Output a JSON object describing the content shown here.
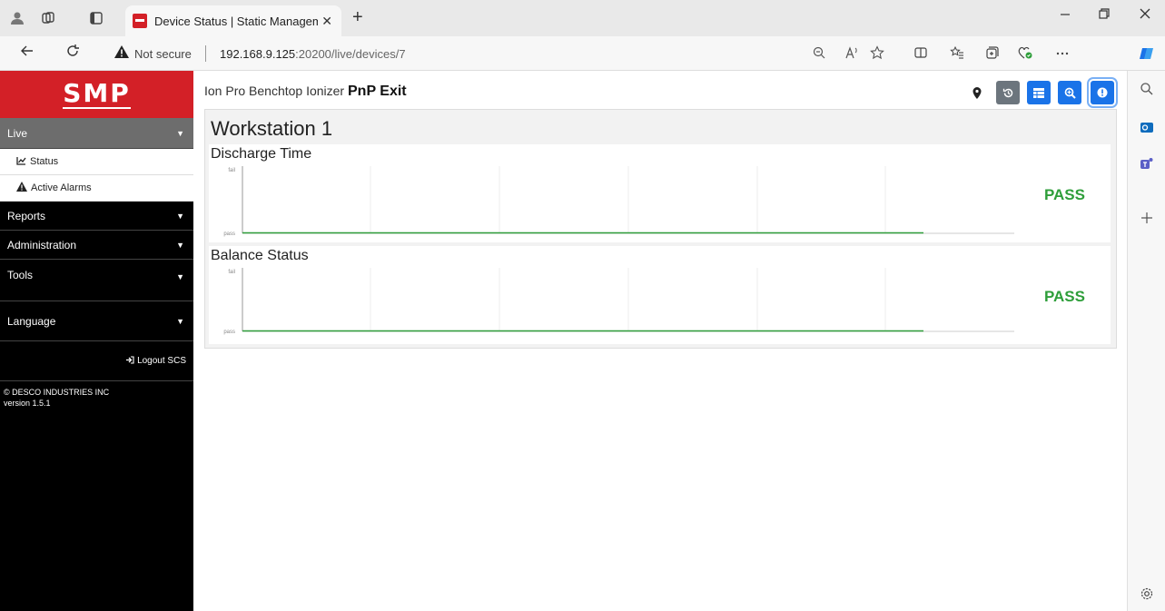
{
  "browser": {
    "tab_title": "Device Status | Static Managemen",
    "close_glyph": "✕",
    "new_tab_glyph": "+",
    "not_secure": "Not secure",
    "url_host": "192.168.9.125",
    "url_rest": ":20200/live/devices/7"
  },
  "sidebar": {
    "logo": "SMP",
    "live": "Live",
    "status": "Status",
    "active_alarms": "Active Alarms",
    "reports": "Reports",
    "administration": "Administration",
    "tools": "Tools",
    "language": "Language",
    "logout": "Logout SCS",
    "copyright": "© DESCO INDUSTRIES INC",
    "version": "version 1.5.1"
  },
  "header": {
    "device_name": "Ion Pro Benchtop Ionizer",
    "device_label": "PnP Exit"
  },
  "workstation": {
    "title": "Workstation 1",
    "panels": [
      {
        "title": "Discharge Time",
        "y_top": "fail",
        "y_bottom": "pass",
        "result": "PASS"
      },
      {
        "title": "Balance Status",
        "y_top": "fail",
        "y_bottom": "pass",
        "result": "PASS"
      }
    ]
  },
  "colors": {
    "brand_red": "#d32027",
    "pass_green": "#2e9e3a",
    "button_blue": "#1a73e8",
    "button_gray": "#6c757d"
  }
}
